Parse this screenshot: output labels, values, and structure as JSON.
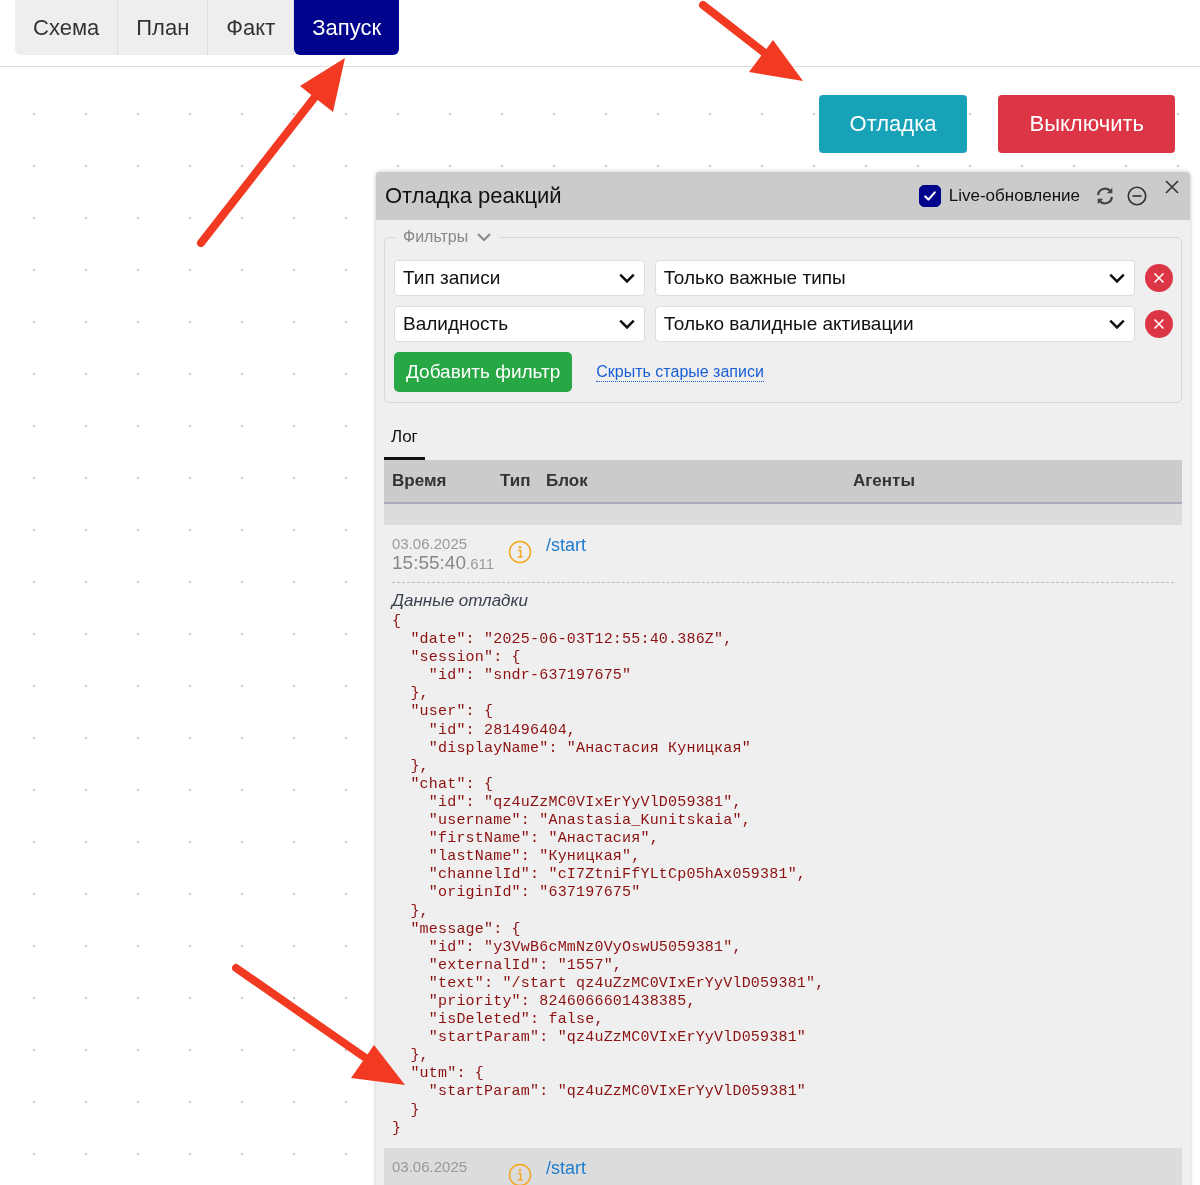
{
  "tabs": [
    {
      "label": "Схема",
      "selected": false
    },
    {
      "label": "План",
      "selected": false
    },
    {
      "label": "Факт",
      "selected": false
    },
    {
      "label": "Запуск",
      "selected": true
    }
  ],
  "buttons": [
    {
      "label": "Отладка",
      "kind": "info"
    },
    {
      "label": "Выключить",
      "kind": "danger"
    }
  ],
  "panel": {
    "title": "Отладка реакций",
    "live_update": {
      "label": "Live-обновление",
      "checked": true
    },
    "filters": {
      "legend": "Фильтры",
      "rows": [
        {
          "field": "Тип записи",
          "value": "Только важные типы"
        },
        {
          "field": "Валидность",
          "value": "Только валидные активации"
        }
      ],
      "add_button": "Добавить фильтр",
      "hide_link": "Скрыть старые записи"
    },
    "tabs": [
      {
        "label": "Лог",
        "selected": true
      }
    ],
    "table": {
      "columns": [
        "Время",
        "Тип",
        "Блок",
        "Агенты"
      ],
      "rows": [
        {
          "date": "03.06.2025",
          "time": "15:55:40",
          "ms": ".611",
          "kind": "info",
          "block": "/start",
          "expanded": true,
          "debug_label": "Данные отладки",
          "debug_json": "{\n  \"date\": \"2025-06-03T12:55:40.386Z\",\n  \"session\": {\n    \"id\": \"sndr-637197675\"\n  },\n  \"user\": {\n    \"id\": 281496404,\n    \"displayName\": \"Анастасия Куницкая\"\n  },\n  \"chat\": {\n    \"id\": \"qz4uZzMC0VIxErYyVlD059381\",\n    \"username\": \"Anastasia_Kunitskaia\",\n    \"firstName\": \"Анастасия\",\n    \"lastName\": \"Куницкая\",\n    \"channelId\": \"cI7ZtniFfYLtCp05hAx059381\",\n    \"originId\": \"637197675\"\n  },\n  \"message\": {\n    \"id\": \"y3VwB6cMmNz0VyOswU5059381\",\n    \"externalId\": \"1557\",\n    \"text\": \"/start qz4uZzMC0VIxErYyVlD059381\",\n    \"priority\": 8246066601438385,\n    \"isDeleted\": false,\n    \"startParam\": \"qz4uZzMC0VIxErYyVlD059381\"\n  },\n  \"utm\": {\n    \"startParam\": \"qz4uZzMC0VIxErYyVlD059381\"\n  }\n}"
        },
        {
          "date": "03.06.2025",
          "kind": "info",
          "block": "/start",
          "expanded": false
        }
      ]
    }
  }
}
